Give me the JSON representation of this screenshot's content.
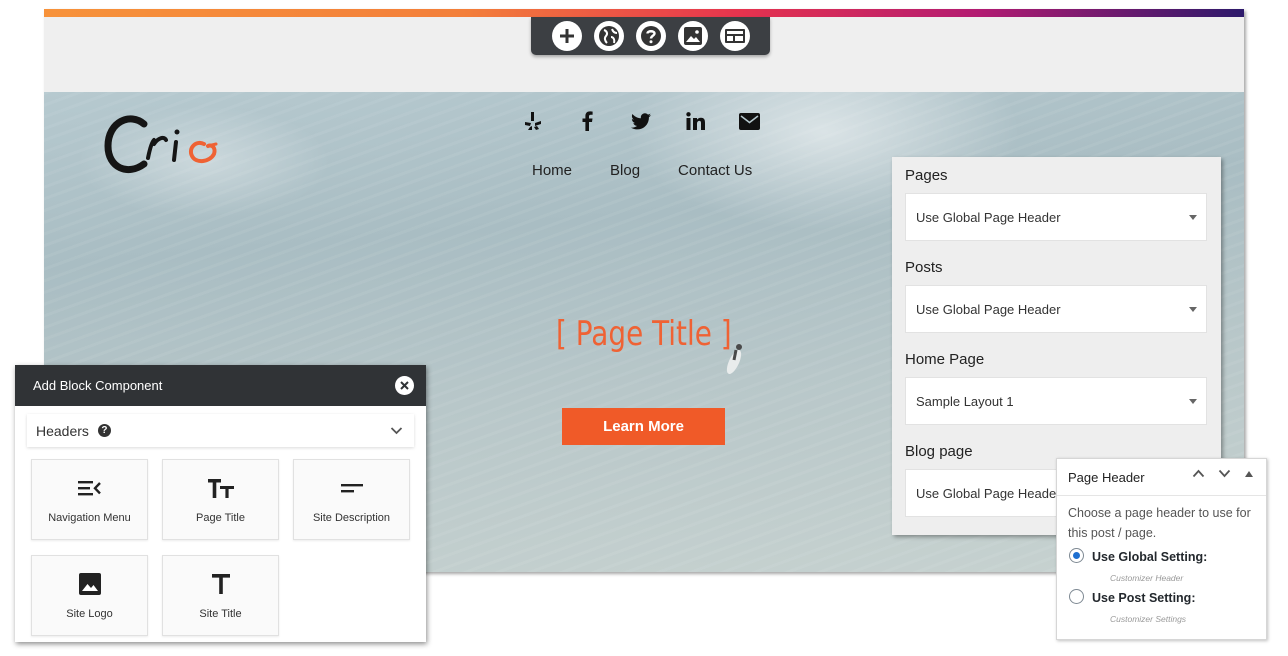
{
  "toolbar": {
    "buttons": [
      "add-icon",
      "globe-icon",
      "help-icon",
      "image-icon",
      "layout-icon"
    ]
  },
  "site": {
    "logo_text": "Crio",
    "social_icons": [
      "yelp-icon",
      "facebook-icon",
      "twitter-icon",
      "linkedin-icon",
      "email-icon"
    ],
    "nav": [
      "Home",
      "Blog",
      "Contact Us"
    ],
    "page_title": "[ Page Title ]",
    "cta_label": "Learn More"
  },
  "page_types": {
    "pages_label": "Pages",
    "pages_value": "Use Global Page Header",
    "posts_label": "Posts",
    "posts_value": "Use Global Page Header",
    "home_label": "Home Page",
    "home_value": "Sample Layout 1",
    "blog_label": "Blog page",
    "blog_value": "Use Global Page Header"
  },
  "add_block": {
    "title": "Add Block Component",
    "category": "Headers",
    "items": [
      {
        "label": "Navigation Menu",
        "icon": "navigation-menu-icon"
      },
      {
        "label": "Page Title",
        "icon": "text-size-icon"
      },
      {
        "label": "Site Description",
        "icon": "short-text-icon"
      },
      {
        "label": "Site Logo",
        "icon": "image-icon"
      },
      {
        "label": "Site Title",
        "icon": "title-icon"
      }
    ]
  },
  "page_header": {
    "title": "Page Header",
    "description": "Choose a page header to use for this post / page.",
    "option_global": "Use Global Setting:",
    "option_global_sub": "Customizer Header",
    "option_post": "Use Post Setting:",
    "option_post_sub": "Customizer Settings",
    "selected": "global"
  },
  "colors": {
    "accent": "#f05a28",
    "title": "#ef6234",
    "dark": "#303336"
  }
}
